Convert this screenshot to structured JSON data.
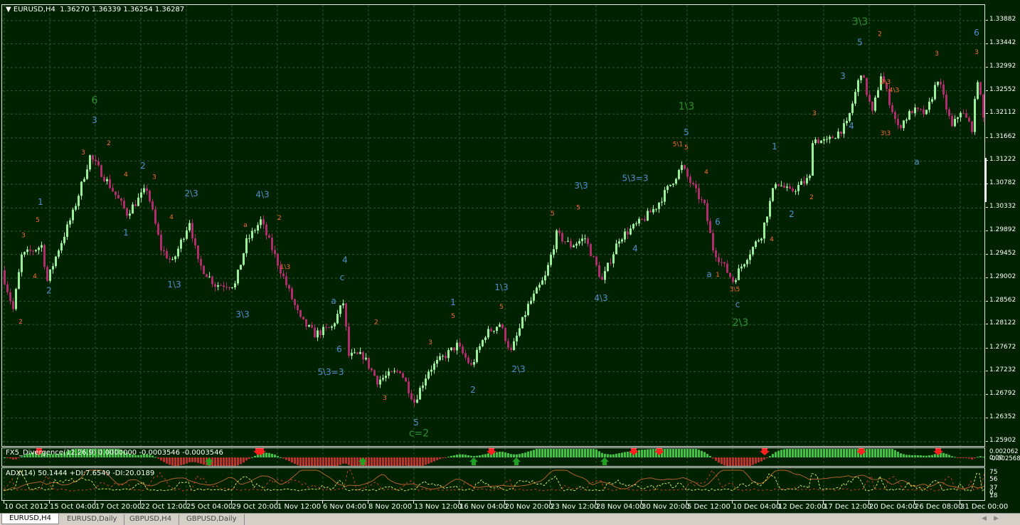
{
  "header": {
    "symbol": "EURUSD,H4",
    "ohlc": "1.36270 1.36339 1.36254 1.36287"
  },
  "indicators": {
    "macd_title": "FX5_Divergence(12,26,9) 0.0000000 -0.0003546 -0.0003546",
    "macd_axis": [
      "0.002062",
      "0.00",
      "-0.002568"
    ],
    "adx_title": "ADX(14) 50.1444 +DI:7.6549 -DI:20.0189",
    "adx_axis": [
      "75",
      "56",
      "37",
      "18",
      "0"
    ]
  },
  "tabs": [
    {
      "label": "EURUSD,H4",
      "active": true
    },
    {
      "label": "EURUSD,Daily"
    },
    {
      "label": "GBPUSD,H4"
    },
    {
      "label": "GBPUSD,Daily"
    }
  ],
  "colors": {
    "bg": "#002200",
    "grid": "#2e5a2e",
    "bull": "#9cf09c",
    "bear": "#b02c6c",
    "wave_small": "#ff6a2a",
    "wave_mid": "#4f8fcf",
    "wave_big": "#2f8f2f",
    "hist_up": "#3fc43f",
    "hist_down": "#c0302a"
  },
  "chart_data": {
    "type": "candlestick",
    "symbol": "EURUSD",
    "timeframe": "H4",
    "price_ticks": [
      "1.33882",
      "1.33442",
      "1.32992",
      "1.32552",
      "1.32112",
      "1.31662",
      "1.31222",
      "1.30782",
      "1.30332",
      "1.29892",
      "1.29452",
      "1.29002",
      "1.28562",
      "1.28122",
      "1.27672",
      "1.27232",
      "1.26792",
      "1.26352",
      "1.25902"
    ],
    "ylim": [
      1.25902,
      1.33882
    ],
    "bars": 346,
    "time_labels": [
      "10 Oct 2012",
      "15 Oct 04:00",
      "17 Oct 20:00",
      "22 Oct 12:00",
      "25 Oct 04:00",
      "29 Oct 20:00",
      "1 Nov 12:00",
      "6 Nov 04:00",
      "8 Nov 20:00",
      "13 Nov 12:00",
      "16 Nov 04:00",
      "20 Nov 20:00",
      "23 Nov 12:00",
      "28 Nov 04:00",
      "30 Nov 20:00",
      "5 Dec 12:00",
      "10 Dec 04:00",
      "12 Dec 20:00",
      "17 Dec 12:00",
      "20 Dec 04:00",
      "26 Dec 08:00",
      "31 Dec 00:00"
    ],
    "bars_per_time_label": 16,
    "swing_path": [
      [
        0,
        1.2915
      ],
      [
        4,
        1.2841
      ],
      [
        7,
        1.2942
      ],
      [
        14,
        1.2962
      ],
      [
        16,
        1.2895
      ],
      [
        20,
        1.2956
      ],
      [
        25,
        1.3023
      ],
      [
        28,
        1.3077
      ],
      [
        31,
        1.3131
      ],
      [
        37,
        1.3084
      ],
      [
        44,
        1.3023
      ],
      [
        51,
        1.307
      ],
      [
        56,
        1.2956
      ],
      [
        60,
        1.2929
      ],
      [
        66,
        1.3009
      ],
      [
        69,
        1.2929
      ],
      [
        75,
        1.2888
      ],
      [
        82,
        1.2888
      ],
      [
        86,
        1.2969
      ],
      [
        91,
        1.3009
      ],
      [
        95,
        1.2956
      ],
      [
        100,
        1.2888
      ],
      [
        105,
        1.2821
      ],
      [
        110,
        1.2794
      ],
      [
        116,
        1.2807
      ],
      [
        120,
        1.2854
      ],
      [
        122,
        1.2753
      ],
      [
        127,
        1.2753
      ],
      [
        132,
        1.2706
      ],
      [
        140,
        1.2726
      ],
      [
        145,
        1.2666
      ],
      [
        150,
        1.2726
      ],
      [
        160,
        1.2773
      ],
      [
        165,
        1.2733
      ],
      [
        170,
        1.2794
      ],
      [
        175,
        1.2814
      ],
      [
        179,
        1.276
      ],
      [
        185,
        1.2848
      ],
      [
        191,
        1.2902
      ],
      [
        195,
        1.2983
      ],
      [
        200,
        1.2962
      ],
      [
        205,
        1.2976
      ],
      [
        211,
        1.2895
      ],
      [
        217,
        1.2976
      ],
      [
        225,
        1.3009
      ],
      [
        230,
        1.3036
      ],
      [
        239,
        1.3111
      ],
      [
        244,
        1.3063
      ],
      [
        247,
        1.3036
      ],
      [
        250,
        1.2956
      ],
      [
        257,
        1.2895
      ],
      [
        262,
        1.2942
      ],
      [
        267,
        1.2983
      ],
      [
        272,
        1.3084
      ],
      [
        277,
        1.3063
      ],
      [
        284,
        1.309
      ],
      [
        285,
        1.3164
      ],
      [
        290,
        1.3158
      ],
      [
        297,
        1.3191
      ],
      [
        302,
        1.3292
      ],
      [
        306,
        1.3212
      ],
      [
        309,
        1.3286
      ],
      [
        315,
        1.3185
      ],
      [
        320,
        1.3218
      ],
      [
        325,
        1.3212
      ],
      [
        329,
        1.3279
      ],
      [
        334,
        1.3185
      ],
      [
        337,
        1.3218
      ],
      [
        341,
        1.3185
      ],
      [
        343,
        1.3279
      ],
      [
        346,
        1.3164
      ]
    ],
    "wave_labels": [
      {
        "t": "6",
        "bar": 32,
        "price": 1.3231,
        "kind": "big"
      },
      {
        "t": "1\\3",
        "bar": 240,
        "price": 1.322,
        "kind": "big"
      },
      {
        "t": "3\\3",
        "bar": 301,
        "price": 1.338,
        "kind": "big"
      },
      {
        "t": "2\\3",
        "bar": 259,
        "price": 1.281,
        "kind": "big"
      },
      {
        "t": "c=2",
        "bar": 146,
        "price": 1.26,
        "kind": "big"
      },
      {
        "t": "3",
        "bar": 32,
        "price": 1.3194,
        "kind": "mid"
      },
      {
        "t": "1",
        "bar": 13,
        "price": 1.3039,
        "kind": "mid"
      },
      {
        "t": "2",
        "bar": 16,
        "price": 1.2871,
        "kind": "mid"
      },
      {
        "t": "2",
        "bar": 49,
        "price": 1.3108,
        "kind": "mid"
      },
      {
        "t": "1",
        "bar": 43,
        "price": 1.2981,
        "kind": "mid"
      },
      {
        "t": "2\\3",
        "bar": 66,
        "price": 1.3055,
        "kind": "mid"
      },
      {
        "t": "1\\3",
        "bar": 60,
        "price": 1.2883,
        "kind": "mid"
      },
      {
        "t": "4\\3",
        "bar": 91,
        "price": 1.3053,
        "kind": "mid"
      },
      {
        "t": "3\\3",
        "bar": 84,
        "price": 1.2826,
        "kind": "mid"
      },
      {
        "t": "4",
        "bar": 120,
        "price": 1.2929,
        "kind": "mid"
      },
      {
        "t": "c",
        "bar": 119,
        "price": 1.2896,
        "kind": "mid"
      },
      {
        "t": "a",
        "bar": 116,
        "price": 1.2852,
        "kind": "mid"
      },
      {
        "t": "6",
        "bar": 118,
        "price": 1.276,
        "kind": "mid"
      },
      {
        "t": "5\\3=3",
        "bar": 115,
        "price": 1.2717,
        "kind": "mid"
      },
      {
        "t": "5",
        "bar": 145,
        "price": 1.2621,
        "kind": "mid"
      },
      {
        "t": "1",
        "bar": 158,
        "price": 1.2849,
        "kind": "mid"
      },
      {
        "t": "2",
        "bar": 165,
        "price": 1.2683,
        "kind": "mid"
      },
      {
        "t": "1\\3",
        "bar": 175,
        "price": 1.2877,
        "kind": "mid"
      },
      {
        "t": "2\\3",
        "bar": 181,
        "price": 1.2722,
        "kind": "mid"
      },
      {
        "t": "3\\3",
        "bar": 203,
        "price": 1.307,
        "kind": "mid"
      },
      {
        "t": "5\\3=3",
        "bar": 222,
        "price": 1.3084,
        "kind": "mid"
      },
      {
        "t": "4\\3",
        "bar": 210,
        "price": 1.2857,
        "kind": "mid"
      },
      {
        "t": "4",
        "bar": 222,
        "price": 1.2951,
        "kind": "mid"
      },
      {
        "t": "5",
        "bar": 240,
        "price": 1.3171,
        "kind": "mid"
      },
      {
        "t": "6",
        "bar": 251,
        "price": 1.3001,
        "kind": "mid"
      },
      {
        "t": "a",
        "bar": 248,
        "price": 1.2902,
        "kind": "mid"
      },
      {
        "t": "c",
        "bar": 258,
        "price": 1.2845,
        "kind": "mid"
      },
      {
        "t": "1",
        "bar": 271,
        "price": 1.3144,
        "kind": "mid"
      },
      {
        "t": "2",
        "bar": 277,
        "price": 1.3016,
        "kind": "mid"
      },
      {
        "t": "3",
        "bar": 295,
        "price": 1.3278,
        "kind": "mid"
      },
      {
        "t": "4",
        "bar": 298,
        "price": 1.3183,
        "kind": "mid"
      },
      {
        "t": "5",
        "bar": 301,
        "price": 1.3342,
        "kind": "mid"
      },
      {
        "t": "a",
        "bar": 321,
        "price": 1.3115,
        "kind": "mid"
      },
      {
        "t": "6",
        "bar": 342,
        "price": 1.336,
        "kind": "mid"
      },
      {
        "t": "3",
        "bar": 28,
        "price": 1.3135,
        "kind": "small"
      },
      {
        "t": "2",
        "bar": 37,
        "price": 1.3152,
        "kind": "small"
      },
      {
        "t": "5",
        "bar": 12,
        "price": 1.3007,
        "kind": "small"
      },
      {
        "t": "4",
        "bar": 11,
        "price": 1.29,
        "kind": "small"
      },
      {
        "t": "2",
        "bar": 6,
        "price": 1.2814,
        "kind": "small"
      },
      {
        "t": "3",
        "bar": 7,
        "price": 1.2978,
        "kind": "small"
      },
      {
        "t": "4",
        "bar": 43,
        "price": 1.3093,
        "kind": "small"
      },
      {
        "t": "3",
        "bar": 53,
        "price": 1.3088,
        "kind": "small"
      },
      {
        "t": "4",
        "bar": 59,
        "price": 1.3012,
        "kind": "small"
      },
      {
        "t": "2",
        "bar": 97,
        "price": 1.3011,
        "kind": "small"
      },
      {
        "t": "1\\3",
        "bar": 99,
        "price": 1.2918,
        "kind": "small"
      },
      {
        "t": "a",
        "bar": 85,
        "price": 1.2997,
        "kind": "small"
      },
      {
        "t": "2",
        "bar": 131,
        "price": 1.2813,
        "kind": "small"
      },
      {
        "t": "3",
        "bar": 134,
        "price": 1.267,
        "kind": "small"
      },
      {
        "t": "3",
        "bar": 150,
        "price": 1.2775,
        "kind": "small"
      },
      {
        "t": "5",
        "bar": 158,
        "price": 1.2825,
        "kind": "small"
      },
      {
        "t": "5",
        "bar": 175,
        "price": 1.2842,
        "kind": "small"
      },
      {
        "t": "5",
        "bar": 193,
        "price": 1.3019,
        "kind": "small"
      },
      {
        "t": "5",
        "bar": 202,
        "price": 1.303,
        "kind": "small"
      },
      {
        "t": "5\\1",
        "bar": 237,
        "price": 1.315,
        "kind": "small"
      },
      {
        "t": "5",
        "bar": 240,
        "price": 1.3144,
        "kind": "small"
      },
      {
        "t": "4",
        "bar": 247,
        "price": 1.3098,
        "kind": "small"
      },
      {
        "t": "3",
        "bar": 285,
        "price": 1.3209,
        "kind": "small"
      },
      {
        "t": "2",
        "bar": 308,
        "price": 1.3359,
        "kind": "small"
      },
      {
        "t": "3",
        "bar": 328,
        "price": 1.3322,
        "kind": "small"
      },
      {
        "t": "3",
        "bar": 342,
        "price": 1.3325,
        "kind": "small"
      },
      {
        "t": "2\\3",
        "bar": 310,
        "price": 1.3268,
        "kind": "small"
      },
      {
        "t": "4\\3",
        "bar": 313,
        "price": 1.3253,
        "kind": "small"
      },
      {
        "t": "3\\3",
        "bar": 310,
        "price": 1.3171,
        "kind": "small"
      },
      {
        "t": "2",
        "bar": 284,
        "price": 1.305,
        "kind": "small"
      },
      {
        "t": "4",
        "bar": 270,
        "price": 1.297,
        "kind": "small"
      },
      {
        "t": "1",
        "bar": 251,
        "price": 1.2903,
        "kind": "small"
      },
      {
        "t": "3\\5",
        "bar": 257,
        "price": 1.2875,
        "kind": "small"
      }
    ],
    "down_arrows": [
      12,
      89,
      90,
      171,
      221,
      230,
      267,
      301,
      328
    ],
    "up_arrows": [
      72,
      126,
      165,
      180,
      211
    ]
  }
}
